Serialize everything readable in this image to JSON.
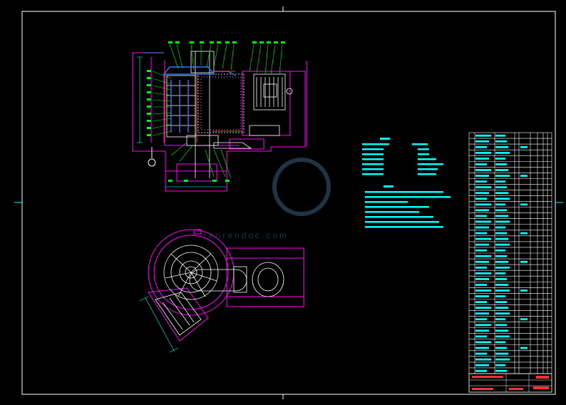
{
  "colors": {
    "background": "#000000",
    "frame": "#ffffff",
    "structure": "#ff00ff",
    "detail": "#ffffff",
    "dimensions": "#00ffff",
    "leaders": "#00ff00",
    "title_stamp": "#ff3333",
    "watermark": "#3a5f7a"
  },
  "watermark": {
    "url": "renrendoc.com"
  },
  "icons": {
    "watermark_logo": "renrendoc-logo-icon",
    "lifting_hook": "lifting-hook-icon"
  }
}
